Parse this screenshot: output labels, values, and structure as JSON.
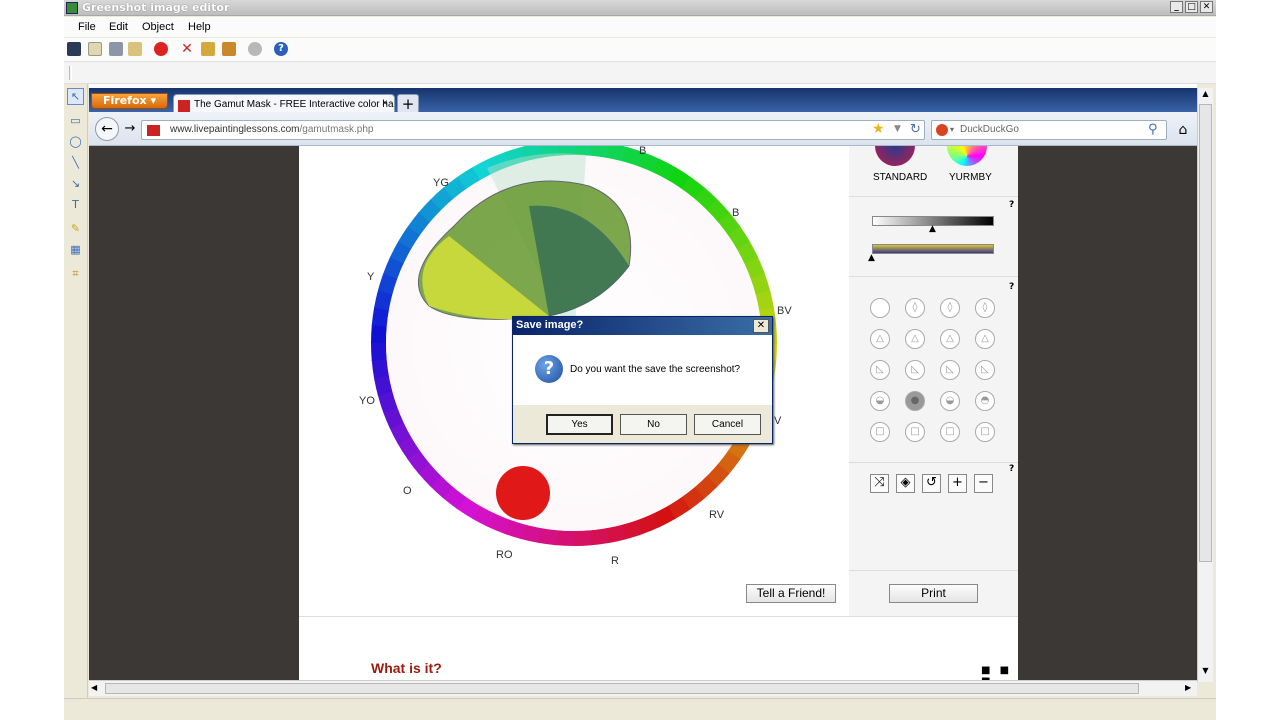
{
  "app": {
    "title": "Greenshot image editor",
    "menus": [
      "File",
      "Edit",
      "Object",
      "Help"
    ],
    "window_buttons": [
      "_",
      "□",
      "✕"
    ]
  },
  "browser": {
    "firefox_label": "Firefox",
    "tab_title": "The Gamut Mask - FREE Interactive color ha...",
    "tab_close": "×",
    "new_tab": "+",
    "url_domain": "www.livepaintinglessons.com",
    "url_path": "/gamutmask.php",
    "search_placeholder": "DuckDuckGo"
  },
  "page": {
    "wheel_labels": [
      "B",
      "B",
      "BV",
      "V",
      "RV",
      "R",
      "RO",
      "O",
      "YO",
      "Y",
      "YG"
    ],
    "presets": [
      "STANDARD",
      "YURMBY"
    ],
    "help_marks": [
      "?",
      "?",
      "?"
    ],
    "tell_friend": "Tell a Friend!",
    "print": "Print",
    "what_is_it": "What is it?"
  },
  "dialog": {
    "title": "Save image?",
    "close": "✕",
    "message": "Do you want the save the screenshot?",
    "icon_glyph": "?",
    "yes": "Yes",
    "no": "No",
    "cancel": "Cancel"
  },
  "colors": {
    "dialog_title_bg": "#0a246a",
    "firefox_orange": "#e87d15",
    "heading_red": "#9b1b0e"
  }
}
